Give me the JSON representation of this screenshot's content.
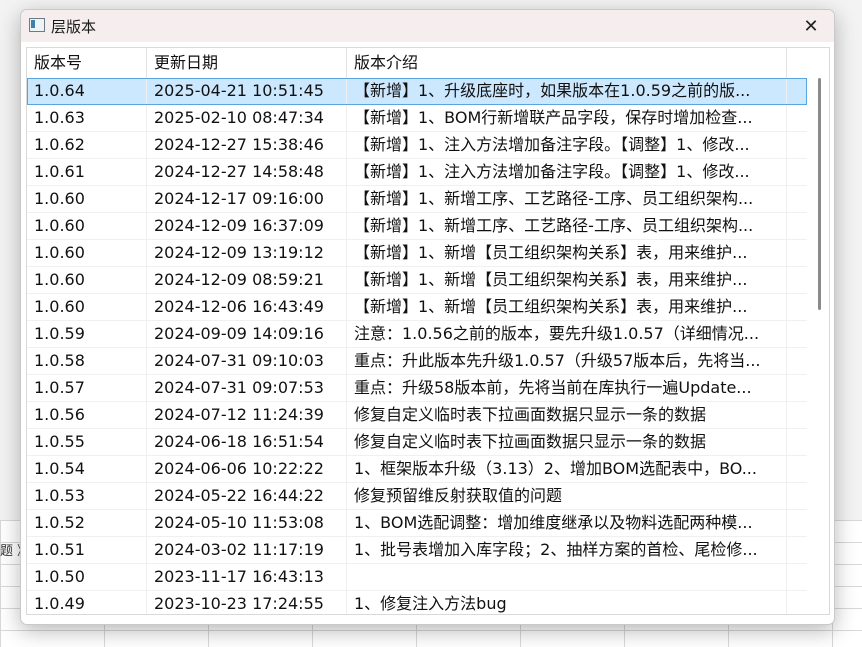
{
  "background": {
    "left_text": "题 》"
  },
  "window": {
    "title": "层版本",
    "close_glyph": "✕"
  },
  "table": {
    "columns": [
      "版本号",
      "更新日期",
      "版本介绍"
    ],
    "rows": [
      {
        "version": "1.0.64",
        "date": "2025-04-21 10:51:45",
        "desc": "【新增】1、升级底座时，如果版本在1.0.59之前的版...",
        "selected": true
      },
      {
        "version": "1.0.63",
        "date": "2025-02-10 08:47:34",
        "desc": "【新增】1、BOM行新增联产品字段，保存时增加检查..."
      },
      {
        "version": "1.0.62",
        "date": "2024-12-27 15:38:46",
        "desc": "【新增】1、注入方法增加备注字段。【调整】1、修改..."
      },
      {
        "version": "1.0.61",
        "date": "2024-12-27 14:58:48",
        "desc": "【新增】1、注入方法增加备注字段。【调整】1、修改..."
      },
      {
        "version": "1.0.60",
        "date": "2024-12-17 09:16:00",
        "desc": "【新增】1、新增工序、工艺路径-工序、员工组织架构..."
      },
      {
        "version": "1.0.60",
        "date": "2024-12-09 16:37:09",
        "desc": "【新增】1、新增工序、工艺路径-工序、员工组织架构..."
      },
      {
        "version": "1.0.60",
        "date": "2024-12-09 13:19:12",
        "desc": "【新增】1、新增【员工组织架构关系】表，用来维护..."
      },
      {
        "version": "1.0.60",
        "date": "2024-12-09 08:59:21",
        "desc": "【新增】1、新增【员工组织架构关系】表，用来维护..."
      },
      {
        "version": "1.0.60",
        "date": "2024-12-06 16:43:49",
        "desc": "【新增】1、新增【员工组织架构关系】表，用来维护..."
      },
      {
        "version": "1.0.59",
        "date": "2024-09-09 14:09:16",
        "desc": "注意：1.0.56之前的版本，要先升级1.0.57（详细情况..."
      },
      {
        "version": "1.0.58",
        "date": "2024-07-31 09:10:03",
        "desc": "重点：升此版本先升级1.0.57（升级57版本后，先将当..."
      },
      {
        "version": "1.0.57",
        "date": "2024-07-31 09:07:53",
        "desc": "重点：升级58版本前，先将当前在库执行一遍Update..."
      },
      {
        "version": "1.0.56",
        "date": "2024-07-12 11:24:39",
        "desc": "修复自定义临时表下拉画面数据只显示一条的数据"
      },
      {
        "version": "1.0.55",
        "date": "2024-06-18 16:51:54",
        "desc": "修复自定义临时表下拉画面数据只显示一条的数据"
      },
      {
        "version": "1.0.54",
        "date": "2024-06-06 10:22:22",
        "desc": "1、框架版本升级（3.13）2、增加BOM选配表中，BO..."
      },
      {
        "version": "1.0.53",
        "date": "2024-05-22 16:44:22",
        "desc": "修复预留维反射获取值的问题"
      },
      {
        "version": "1.0.52",
        "date": "2024-05-10 11:53:08",
        "desc": "1、BOM选配调整：增加维度继承以及物料选配两种模..."
      },
      {
        "version": "1.0.51",
        "date": "2024-03-02 11:17:19",
        "desc": "1、批号表增加入库字段；2、抽样方案的首检、尾检修..."
      },
      {
        "version": "1.0.50",
        "date": "2023-11-17 16:43:13",
        "desc": ""
      },
      {
        "version": "1.0.49",
        "date": "2023-10-23 17:24:55",
        "desc": "1、修复注入方法bug"
      }
    ]
  }
}
